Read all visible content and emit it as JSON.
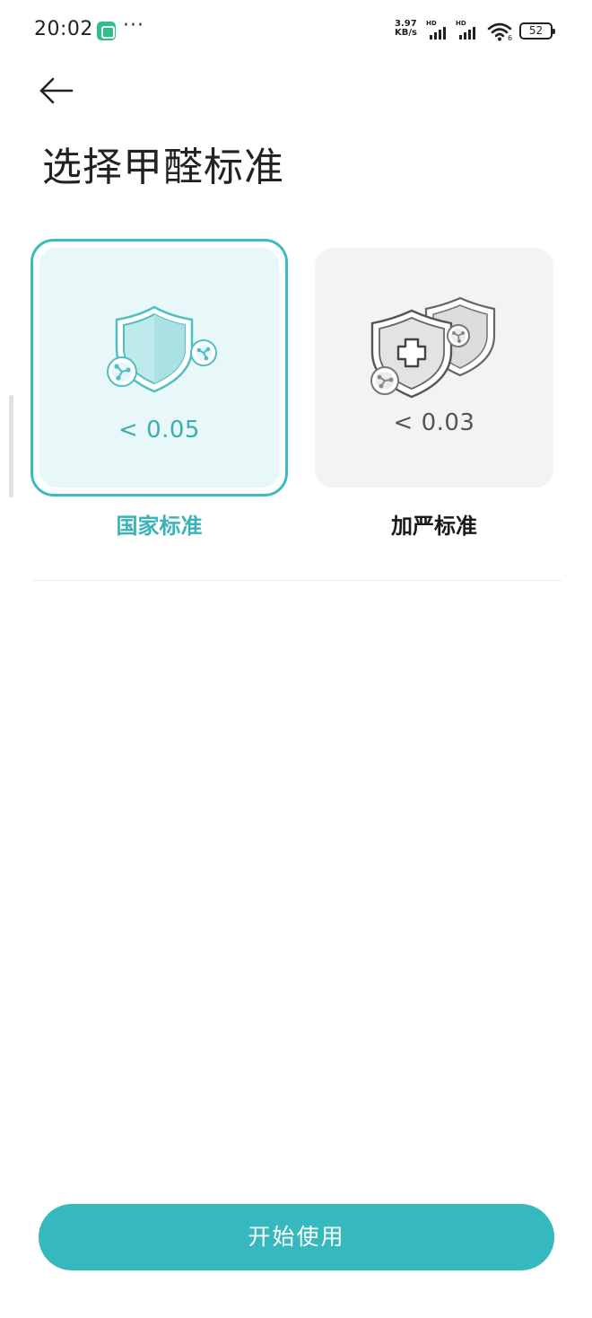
{
  "status_bar": {
    "time": "20:02",
    "more": "···",
    "net_speed_value": "3.97",
    "net_speed_unit": "KB/s",
    "signal1_label": "HD",
    "signal2_label": "HD",
    "wifi_label": "6",
    "battery": "52",
    "app_icon": "mi-home-icon"
  },
  "header": {
    "title": "选择甲醛标准"
  },
  "options": [
    {
      "label": "国家标准",
      "value": "< 0.05",
      "selected": true,
      "icon": "shield-molecule-icon"
    },
    {
      "label": "加严标准",
      "value": "< 0.03",
      "selected": false,
      "icon": "double-shield-plus-icon"
    }
  ],
  "footer": {
    "start_button_label": "开始使用"
  },
  "colors": {
    "accent": "#35b9be",
    "selected_card_bg": "#e8f8f8",
    "unselected_card_bg": "#f3f3f3"
  }
}
